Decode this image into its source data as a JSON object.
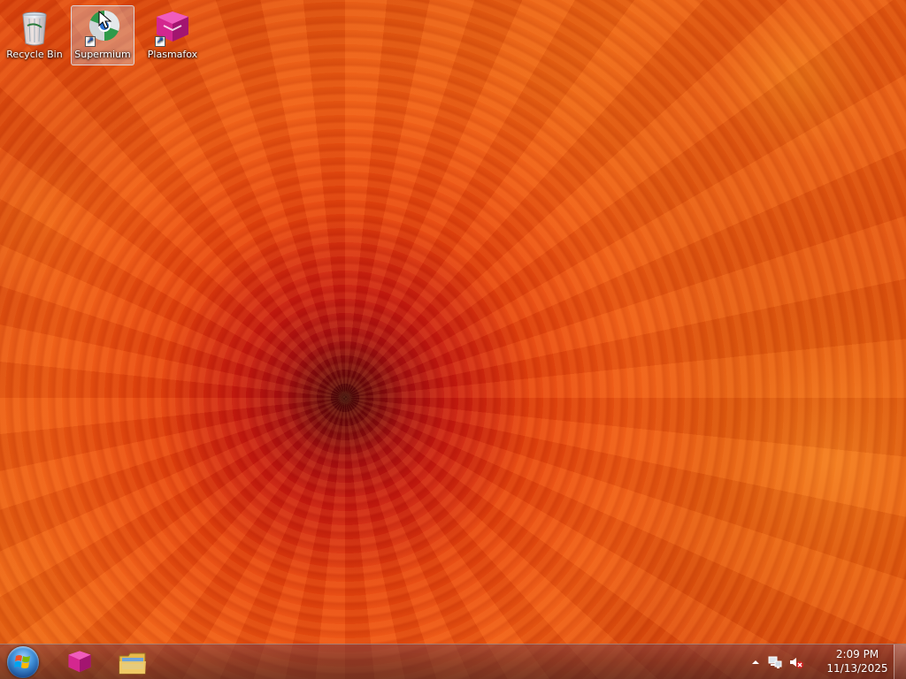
{
  "desktop": {
    "icons": [
      {
        "label": "Recycle Bin",
        "icon": "recycle-bin-icon"
      },
      {
        "label": "Supermium",
        "icon": "supermium-browser-icon",
        "selected": true
      },
      {
        "label": "Plasmafox",
        "icon": "plasmafox-browser-icon"
      }
    ]
  },
  "taskbar": {
    "start_icon": "windows-start-orb-icon",
    "pinned": [
      {
        "icon": "plasmafox-browser-icon"
      },
      {
        "icon": "file-explorer-folder-icon"
      }
    ],
    "tray": {
      "show_hidden_icon": "chevron-up-icon",
      "network_icon": "network-icon",
      "volume_icon": "volume-muted-icon"
    },
    "clock": {
      "time": "2:09 PM",
      "date": "11/13/2025"
    }
  },
  "colors": {
    "accent": "#1b4f94",
    "plasmafox": "#d4278f"
  }
}
